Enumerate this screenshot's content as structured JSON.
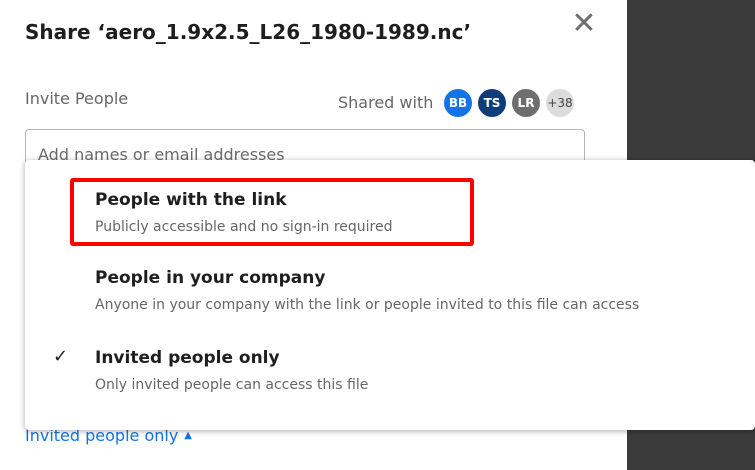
{
  "dialog": {
    "title": "Share ‘aero_1.9x2.5_L26_1980-1989.nc’",
    "close_glyph": "✕",
    "invite_label": "Invite People",
    "shared_with_label": "Shared with",
    "avatars": [
      {
        "initials": "BB",
        "color": "#1473e6"
      },
      {
        "initials": "TS",
        "color": "#0f3d7a"
      },
      {
        "initials": "LR",
        "color": "#6e6e6e"
      },
      {
        "initials": "+38",
        "color": "#dcdcdc"
      }
    ],
    "input_placeholder": "Add names or email addresses",
    "access_link_label": "Invited people only",
    "access_link_caret": "▲"
  },
  "menu": {
    "items": [
      {
        "label": "People with the link",
        "description": "Publicly accessible and no sign-in required",
        "checked": false
      },
      {
        "label": "People in your company",
        "description": "Anyone in your company with the link or people invited to this file can access",
        "checked": false
      },
      {
        "label": "Invited people only",
        "description": "Only invited people can access this file",
        "checked": true,
        "check_glyph": "✓"
      }
    ]
  },
  "colors": {
    "accent": "#1473e6",
    "highlight": "#ff0000",
    "backdrop": "#3b3b3b"
  },
  "icons": {
    "close": "close-icon",
    "check": "checkmark-icon",
    "caret": "caret-up-icon"
  }
}
